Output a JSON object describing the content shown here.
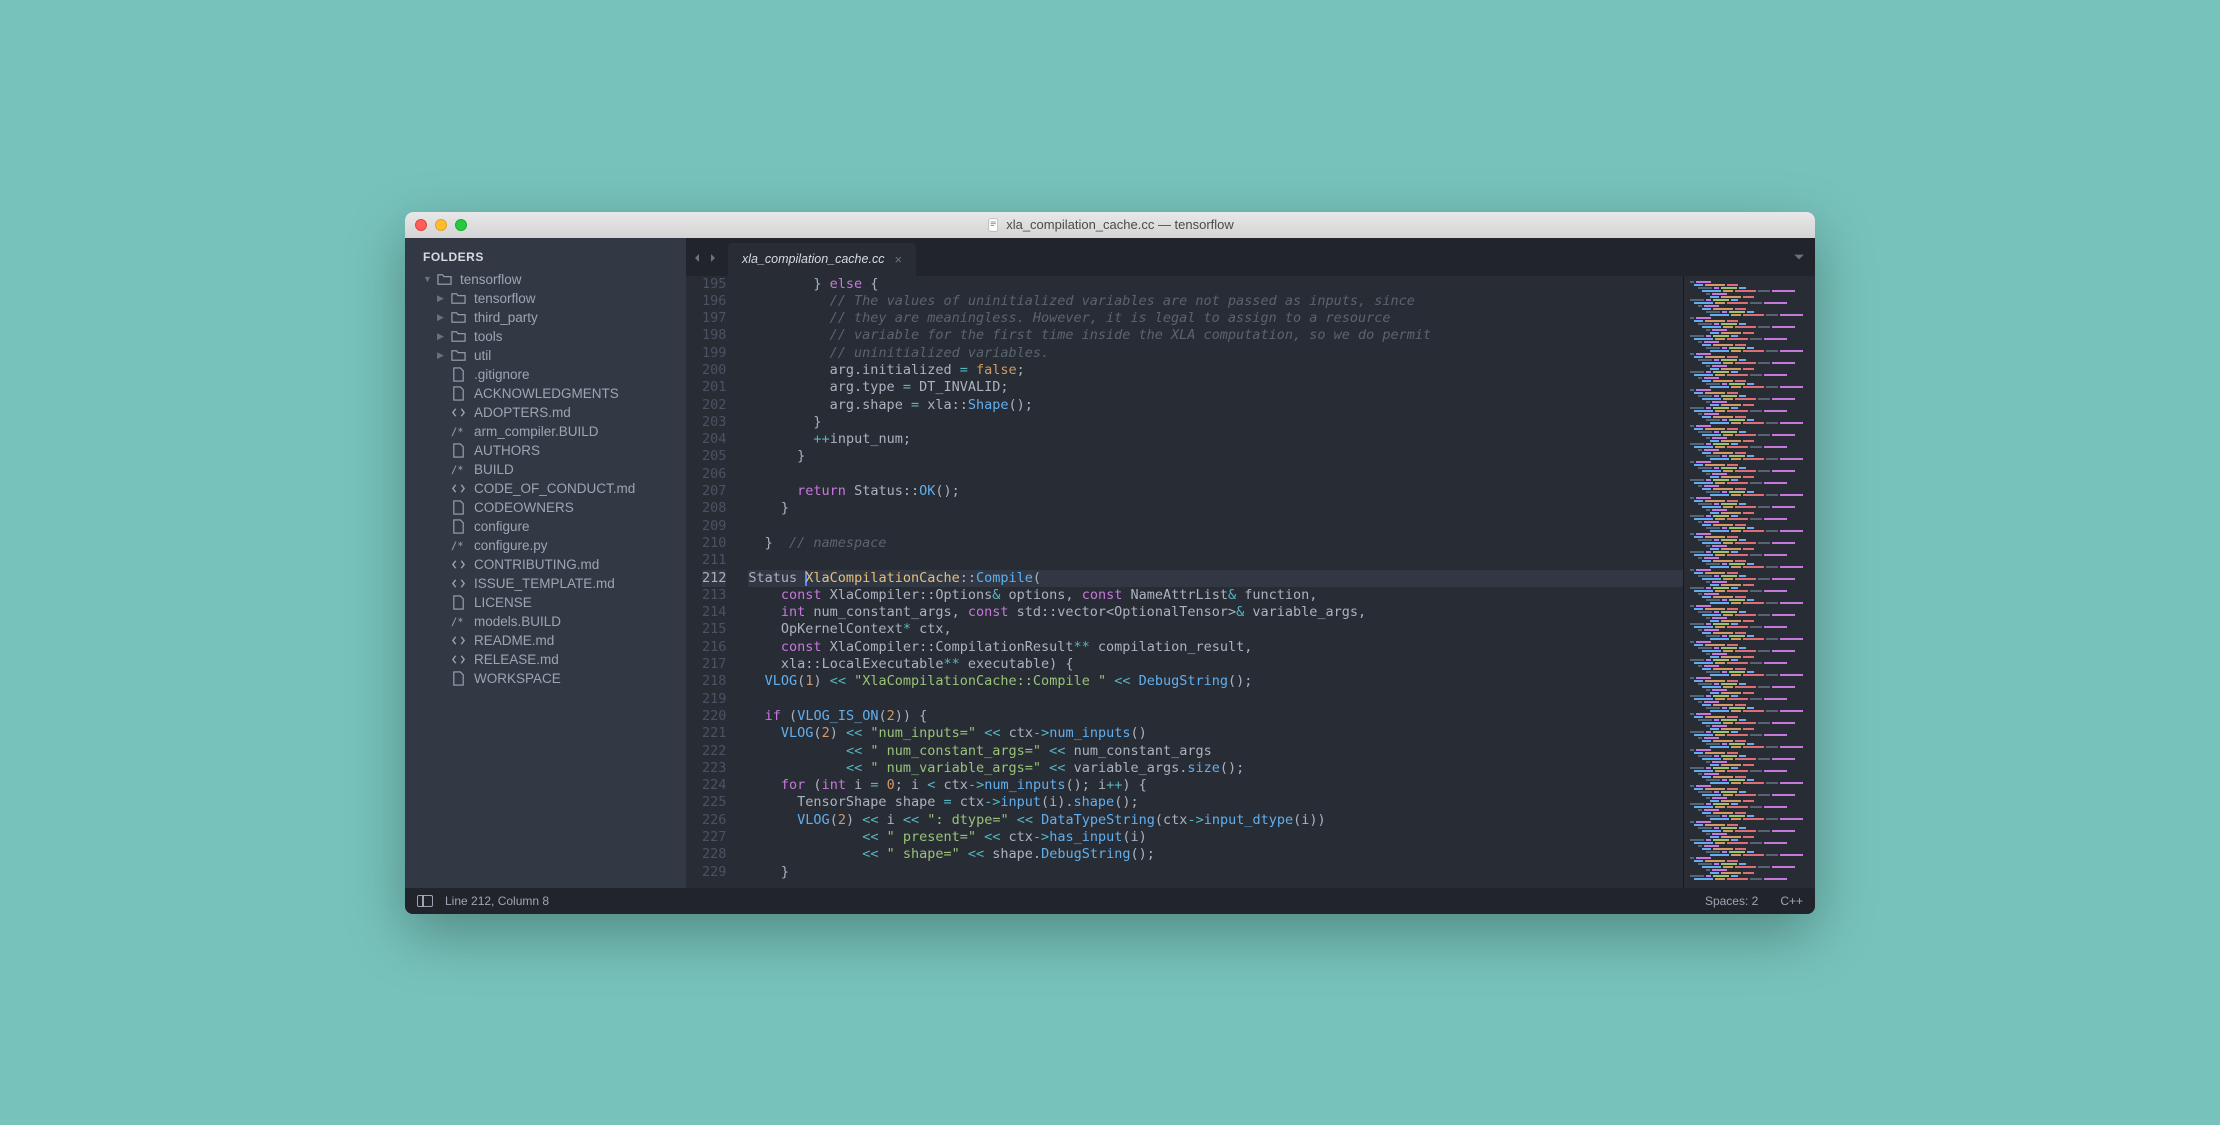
{
  "window": {
    "title": "xla_compilation_cache.cc — tensorflow"
  },
  "sidebar": {
    "header": "FOLDERS",
    "tree": [
      {
        "label": "tensorflow",
        "type": "folder",
        "indent": 0,
        "disclosure": "▼"
      },
      {
        "label": "tensorflow",
        "type": "folder",
        "indent": 1,
        "disclosure": "▶"
      },
      {
        "label": "third_party",
        "type": "folder",
        "indent": 1,
        "disclosure": "▶"
      },
      {
        "label": "tools",
        "type": "folder",
        "indent": 1,
        "disclosure": "▶"
      },
      {
        "label": "util",
        "type": "folder",
        "indent": 1,
        "disclosure": "▶"
      },
      {
        "label": ".gitignore",
        "type": "file",
        "indent": 1,
        "icon": "file"
      },
      {
        "label": "ACKNOWLEDGMENTS",
        "type": "file",
        "indent": 1,
        "icon": "file"
      },
      {
        "label": "ADOPTERS.md",
        "type": "file",
        "indent": 1,
        "icon": "code"
      },
      {
        "label": "arm_compiler.BUILD",
        "type": "file",
        "indent": 1,
        "icon": "comment"
      },
      {
        "label": "AUTHORS",
        "type": "file",
        "indent": 1,
        "icon": "file"
      },
      {
        "label": "BUILD",
        "type": "file",
        "indent": 1,
        "icon": "comment"
      },
      {
        "label": "CODE_OF_CONDUCT.md",
        "type": "file",
        "indent": 1,
        "icon": "code"
      },
      {
        "label": "CODEOWNERS",
        "type": "file",
        "indent": 1,
        "icon": "file"
      },
      {
        "label": "configure",
        "type": "file",
        "indent": 1,
        "icon": "file"
      },
      {
        "label": "configure.py",
        "type": "file",
        "indent": 1,
        "icon": "comment"
      },
      {
        "label": "CONTRIBUTING.md",
        "type": "file",
        "indent": 1,
        "icon": "code"
      },
      {
        "label": "ISSUE_TEMPLATE.md",
        "type": "file",
        "indent": 1,
        "icon": "code"
      },
      {
        "label": "LICENSE",
        "type": "file",
        "indent": 1,
        "icon": "file"
      },
      {
        "label": "models.BUILD",
        "type": "file",
        "indent": 1,
        "icon": "comment"
      },
      {
        "label": "README.md",
        "type": "file",
        "indent": 1,
        "icon": "code"
      },
      {
        "label": "RELEASE.md",
        "type": "file",
        "indent": 1,
        "icon": "code"
      },
      {
        "label": "WORKSPACE",
        "type": "file",
        "indent": 1,
        "icon": "file"
      }
    ]
  },
  "tabs": [
    {
      "label": "xla_compilation_cache.cc",
      "active": true
    }
  ],
  "gutter": {
    "start": 195,
    "end": 229,
    "current": 212
  },
  "code_lines": [
    {
      "n": 195,
      "segs": [
        {
          "t": "        } ",
          "c": "pl"
        },
        {
          "t": "else",
          "c": "kw"
        },
        {
          "t": " {",
          "c": "pl"
        }
      ]
    },
    {
      "n": 196,
      "segs": [
        {
          "t": "          ",
          "c": "pl"
        },
        {
          "t": "// The values of uninitialized variables are not passed as inputs, since",
          "c": "cm"
        }
      ]
    },
    {
      "n": 197,
      "segs": [
        {
          "t": "          ",
          "c": "pl"
        },
        {
          "t": "// they are meaningless. However, it is legal to assign to a resource",
          "c": "cm"
        }
      ]
    },
    {
      "n": 198,
      "segs": [
        {
          "t": "          ",
          "c": "pl"
        },
        {
          "t": "// variable for the first time inside the XLA computation, so we do permit",
          "c": "cm"
        }
      ]
    },
    {
      "n": 199,
      "segs": [
        {
          "t": "          ",
          "c": "pl"
        },
        {
          "t": "// uninitialized variables.",
          "c": "cm"
        }
      ]
    },
    {
      "n": 200,
      "segs": [
        {
          "t": "          arg.initialized ",
          "c": "pl"
        },
        {
          "t": "=",
          "c": "op"
        },
        {
          "t": " ",
          "c": "pl"
        },
        {
          "t": "false",
          "c": "const"
        },
        {
          "t": ";",
          "c": "pl"
        }
      ]
    },
    {
      "n": 201,
      "segs": [
        {
          "t": "          arg.type ",
          "c": "pl"
        },
        {
          "t": "=",
          "c": "op"
        },
        {
          "t": " DT_INVALID;",
          "c": "pl"
        }
      ]
    },
    {
      "n": 202,
      "segs": [
        {
          "t": "          arg.shape ",
          "c": "pl"
        },
        {
          "t": "=",
          "c": "op"
        },
        {
          "t": " xla",
          "c": "pl"
        },
        {
          "t": "::",
          "c": "pl"
        },
        {
          "t": "Shape",
          "c": "fn"
        },
        {
          "t": "();",
          "c": "pl"
        }
      ]
    },
    {
      "n": 203,
      "segs": [
        {
          "t": "        }",
          "c": "pl"
        }
      ]
    },
    {
      "n": 204,
      "segs": [
        {
          "t": "        ",
          "c": "pl"
        },
        {
          "t": "++",
          "c": "op"
        },
        {
          "t": "input_num;",
          "c": "pl"
        }
      ]
    },
    {
      "n": 205,
      "segs": [
        {
          "t": "      }",
          "c": "pl"
        }
      ]
    },
    {
      "n": 206,
      "segs": []
    },
    {
      "n": 207,
      "segs": [
        {
          "t": "      ",
          "c": "pl"
        },
        {
          "t": "return",
          "c": "kw"
        },
        {
          "t": " Status",
          "c": "pl"
        },
        {
          "t": "::",
          "c": "pl"
        },
        {
          "t": "OK",
          "c": "fn"
        },
        {
          "t": "();",
          "c": "pl"
        }
      ]
    },
    {
      "n": 208,
      "segs": [
        {
          "t": "    }",
          "c": "pl"
        }
      ]
    },
    {
      "n": 209,
      "segs": []
    },
    {
      "n": 210,
      "segs": [
        {
          "t": "  }  ",
          "c": "pl"
        },
        {
          "t": "// namespace",
          "c": "cm"
        }
      ]
    },
    {
      "n": 211,
      "segs": []
    },
    {
      "n": 212,
      "segs": [
        {
          "t": "Status ",
          "c": "pl"
        },
        {
          "t": "|",
          "c": "cursor"
        },
        {
          "t": "XlaCompilationCache",
          "c": "typ"
        },
        {
          "t": "::",
          "c": "pl"
        },
        {
          "t": "Compile",
          "c": "fn"
        },
        {
          "t": "(",
          "c": "pl"
        }
      ]
    },
    {
      "n": 213,
      "segs": [
        {
          "t": "    ",
          "c": "pl"
        },
        {
          "t": "const",
          "c": "kw"
        },
        {
          "t": " XlaCompiler",
          "c": "pl"
        },
        {
          "t": "::",
          "c": "pl"
        },
        {
          "t": "Options",
          "c": "pl"
        },
        {
          "t": "&",
          "c": "op"
        },
        {
          "t": " options, ",
          "c": "pl"
        },
        {
          "t": "const",
          "c": "kw"
        },
        {
          "t": " NameAttrList",
          "c": "pl"
        },
        {
          "t": "&",
          "c": "op"
        },
        {
          "t": " function,",
          "c": "pl"
        }
      ]
    },
    {
      "n": 214,
      "segs": [
        {
          "t": "    ",
          "c": "pl"
        },
        {
          "t": "int",
          "c": "kw"
        },
        {
          "t": " num_constant_args, ",
          "c": "pl"
        },
        {
          "t": "const",
          "c": "kw"
        },
        {
          "t": " std",
          "c": "pl"
        },
        {
          "t": "::",
          "c": "pl"
        },
        {
          "t": "vector<OptionalTensor>",
          "c": "pl"
        },
        {
          "t": "&",
          "c": "op"
        },
        {
          "t": " variable_args,",
          "c": "pl"
        }
      ]
    },
    {
      "n": 215,
      "segs": [
        {
          "t": "    OpKernelContext",
          "c": "pl"
        },
        {
          "t": "*",
          "c": "op"
        },
        {
          "t": " ctx,",
          "c": "pl"
        }
      ]
    },
    {
      "n": 216,
      "segs": [
        {
          "t": "    ",
          "c": "pl"
        },
        {
          "t": "const",
          "c": "kw"
        },
        {
          "t": " XlaCompiler",
          "c": "pl"
        },
        {
          "t": "::",
          "c": "pl"
        },
        {
          "t": "CompilationResult",
          "c": "pl"
        },
        {
          "t": "**",
          "c": "op"
        },
        {
          "t": " compilation_result,",
          "c": "pl"
        }
      ]
    },
    {
      "n": 217,
      "segs": [
        {
          "t": "    xla",
          "c": "pl"
        },
        {
          "t": "::",
          "c": "pl"
        },
        {
          "t": "LocalExecutable",
          "c": "pl"
        },
        {
          "t": "**",
          "c": "op"
        },
        {
          "t": " executable) {",
          "c": "pl"
        }
      ]
    },
    {
      "n": 218,
      "segs": [
        {
          "t": "  ",
          "c": "pl"
        },
        {
          "t": "VLOG",
          "c": "fn"
        },
        {
          "t": "(",
          "c": "pl"
        },
        {
          "t": "1",
          "c": "num"
        },
        {
          "t": ") ",
          "c": "pl"
        },
        {
          "t": "<<",
          "c": "op"
        },
        {
          "t": " ",
          "c": "pl"
        },
        {
          "t": "\"XlaCompilationCache::Compile \"",
          "c": "str"
        },
        {
          "t": " ",
          "c": "pl"
        },
        {
          "t": "<<",
          "c": "op"
        },
        {
          "t": " ",
          "c": "pl"
        },
        {
          "t": "DebugString",
          "c": "fn"
        },
        {
          "t": "();",
          "c": "pl"
        }
      ]
    },
    {
      "n": 219,
      "segs": []
    },
    {
      "n": 220,
      "segs": [
        {
          "t": "  ",
          "c": "pl"
        },
        {
          "t": "if",
          "c": "kw"
        },
        {
          "t": " (",
          "c": "pl"
        },
        {
          "t": "VLOG_IS_ON",
          "c": "fn"
        },
        {
          "t": "(",
          "c": "pl"
        },
        {
          "t": "2",
          "c": "num"
        },
        {
          "t": ")) {",
          "c": "pl"
        }
      ]
    },
    {
      "n": 221,
      "segs": [
        {
          "t": "    ",
          "c": "pl"
        },
        {
          "t": "VLOG",
          "c": "fn"
        },
        {
          "t": "(",
          "c": "pl"
        },
        {
          "t": "2",
          "c": "num"
        },
        {
          "t": ") ",
          "c": "pl"
        },
        {
          "t": "<<",
          "c": "op"
        },
        {
          "t": " ",
          "c": "pl"
        },
        {
          "t": "\"num_inputs=\"",
          "c": "str"
        },
        {
          "t": " ",
          "c": "pl"
        },
        {
          "t": "<<",
          "c": "op"
        },
        {
          "t": " ctx",
          "c": "pl"
        },
        {
          "t": "->",
          "c": "op"
        },
        {
          "t": "num_inputs",
          "c": "fn"
        },
        {
          "t": "()",
          "c": "pl"
        }
      ]
    },
    {
      "n": 222,
      "segs": [
        {
          "t": "            ",
          "c": "pl"
        },
        {
          "t": "<<",
          "c": "op"
        },
        {
          "t": " ",
          "c": "pl"
        },
        {
          "t": "\" num_constant_args=\"",
          "c": "str"
        },
        {
          "t": " ",
          "c": "pl"
        },
        {
          "t": "<<",
          "c": "op"
        },
        {
          "t": " num_constant_args",
          "c": "pl"
        }
      ]
    },
    {
      "n": 223,
      "segs": [
        {
          "t": "            ",
          "c": "pl"
        },
        {
          "t": "<<",
          "c": "op"
        },
        {
          "t": " ",
          "c": "pl"
        },
        {
          "t": "\" num_variable_args=\"",
          "c": "str"
        },
        {
          "t": " ",
          "c": "pl"
        },
        {
          "t": "<<",
          "c": "op"
        },
        {
          "t": " variable_args.",
          "c": "pl"
        },
        {
          "t": "size",
          "c": "fn"
        },
        {
          "t": "();",
          "c": "pl"
        }
      ]
    },
    {
      "n": 224,
      "segs": [
        {
          "t": "    ",
          "c": "pl"
        },
        {
          "t": "for",
          "c": "kw"
        },
        {
          "t": " (",
          "c": "pl"
        },
        {
          "t": "int",
          "c": "kw"
        },
        {
          "t": " i ",
          "c": "pl"
        },
        {
          "t": "=",
          "c": "op"
        },
        {
          "t": " ",
          "c": "pl"
        },
        {
          "t": "0",
          "c": "num"
        },
        {
          "t": "; i ",
          "c": "pl"
        },
        {
          "t": "<",
          "c": "op"
        },
        {
          "t": " ctx",
          "c": "pl"
        },
        {
          "t": "->",
          "c": "op"
        },
        {
          "t": "num_inputs",
          "c": "fn"
        },
        {
          "t": "(); i",
          "c": "pl"
        },
        {
          "t": "++",
          "c": "op"
        },
        {
          "t": ") {",
          "c": "pl"
        }
      ]
    },
    {
      "n": 225,
      "segs": [
        {
          "t": "      TensorShape shape ",
          "c": "pl"
        },
        {
          "t": "=",
          "c": "op"
        },
        {
          "t": " ctx",
          "c": "pl"
        },
        {
          "t": "->",
          "c": "op"
        },
        {
          "t": "input",
          "c": "fn"
        },
        {
          "t": "(i).",
          "c": "pl"
        },
        {
          "t": "shape",
          "c": "fn"
        },
        {
          "t": "();",
          "c": "pl"
        }
      ]
    },
    {
      "n": 226,
      "segs": [
        {
          "t": "      ",
          "c": "pl"
        },
        {
          "t": "VLOG",
          "c": "fn"
        },
        {
          "t": "(",
          "c": "pl"
        },
        {
          "t": "2",
          "c": "num"
        },
        {
          "t": ") ",
          "c": "pl"
        },
        {
          "t": "<<",
          "c": "op"
        },
        {
          "t": " i ",
          "c": "pl"
        },
        {
          "t": "<<",
          "c": "op"
        },
        {
          "t": " ",
          "c": "pl"
        },
        {
          "t": "\": dtype=\"",
          "c": "str"
        },
        {
          "t": " ",
          "c": "pl"
        },
        {
          "t": "<<",
          "c": "op"
        },
        {
          "t": " ",
          "c": "pl"
        },
        {
          "t": "DataTypeString",
          "c": "fn"
        },
        {
          "t": "(ctx",
          "c": "pl"
        },
        {
          "t": "->",
          "c": "op"
        },
        {
          "t": "input_dtype",
          "c": "fn"
        },
        {
          "t": "(i))",
          "c": "pl"
        }
      ]
    },
    {
      "n": 227,
      "segs": [
        {
          "t": "              ",
          "c": "pl"
        },
        {
          "t": "<<",
          "c": "op"
        },
        {
          "t": " ",
          "c": "pl"
        },
        {
          "t": "\" present=\"",
          "c": "str"
        },
        {
          "t": " ",
          "c": "pl"
        },
        {
          "t": "<<",
          "c": "op"
        },
        {
          "t": " ctx",
          "c": "pl"
        },
        {
          "t": "->",
          "c": "op"
        },
        {
          "t": "has_input",
          "c": "fn"
        },
        {
          "t": "(i)",
          "c": "pl"
        }
      ]
    },
    {
      "n": 228,
      "segs": [
        {
          "t": "              ",
          "c": "pl"
        },
        {
          "t": "<<",
          "c": "op"
        },
        {
          "t": " ",
          "c": "pl"
        },
        {
          "t": "\" shape=\"",
          "c": "str"
        },
        {
          "t": " ",
          "c": "pl"
        },
        {
          "t": "<<",
          "c": "op"
        },
        {
          "t": " shape.",
          "c": "pl"
        },
        {
          "t": "DebugString",
          "c": "fn"
        },
        {
          "t": "();",
          "c": "pl"
        }
      ]
    },
    {
      "n": 229,
      "segs": [
        {
          "t": "    }",
          "c": "pl"
        }
      ]
    }
  ],
  "status": {
    "position": "Line 212, Column 8",
    "spaces": "Spaces: 2",
    "language": "C++"
  }
}
